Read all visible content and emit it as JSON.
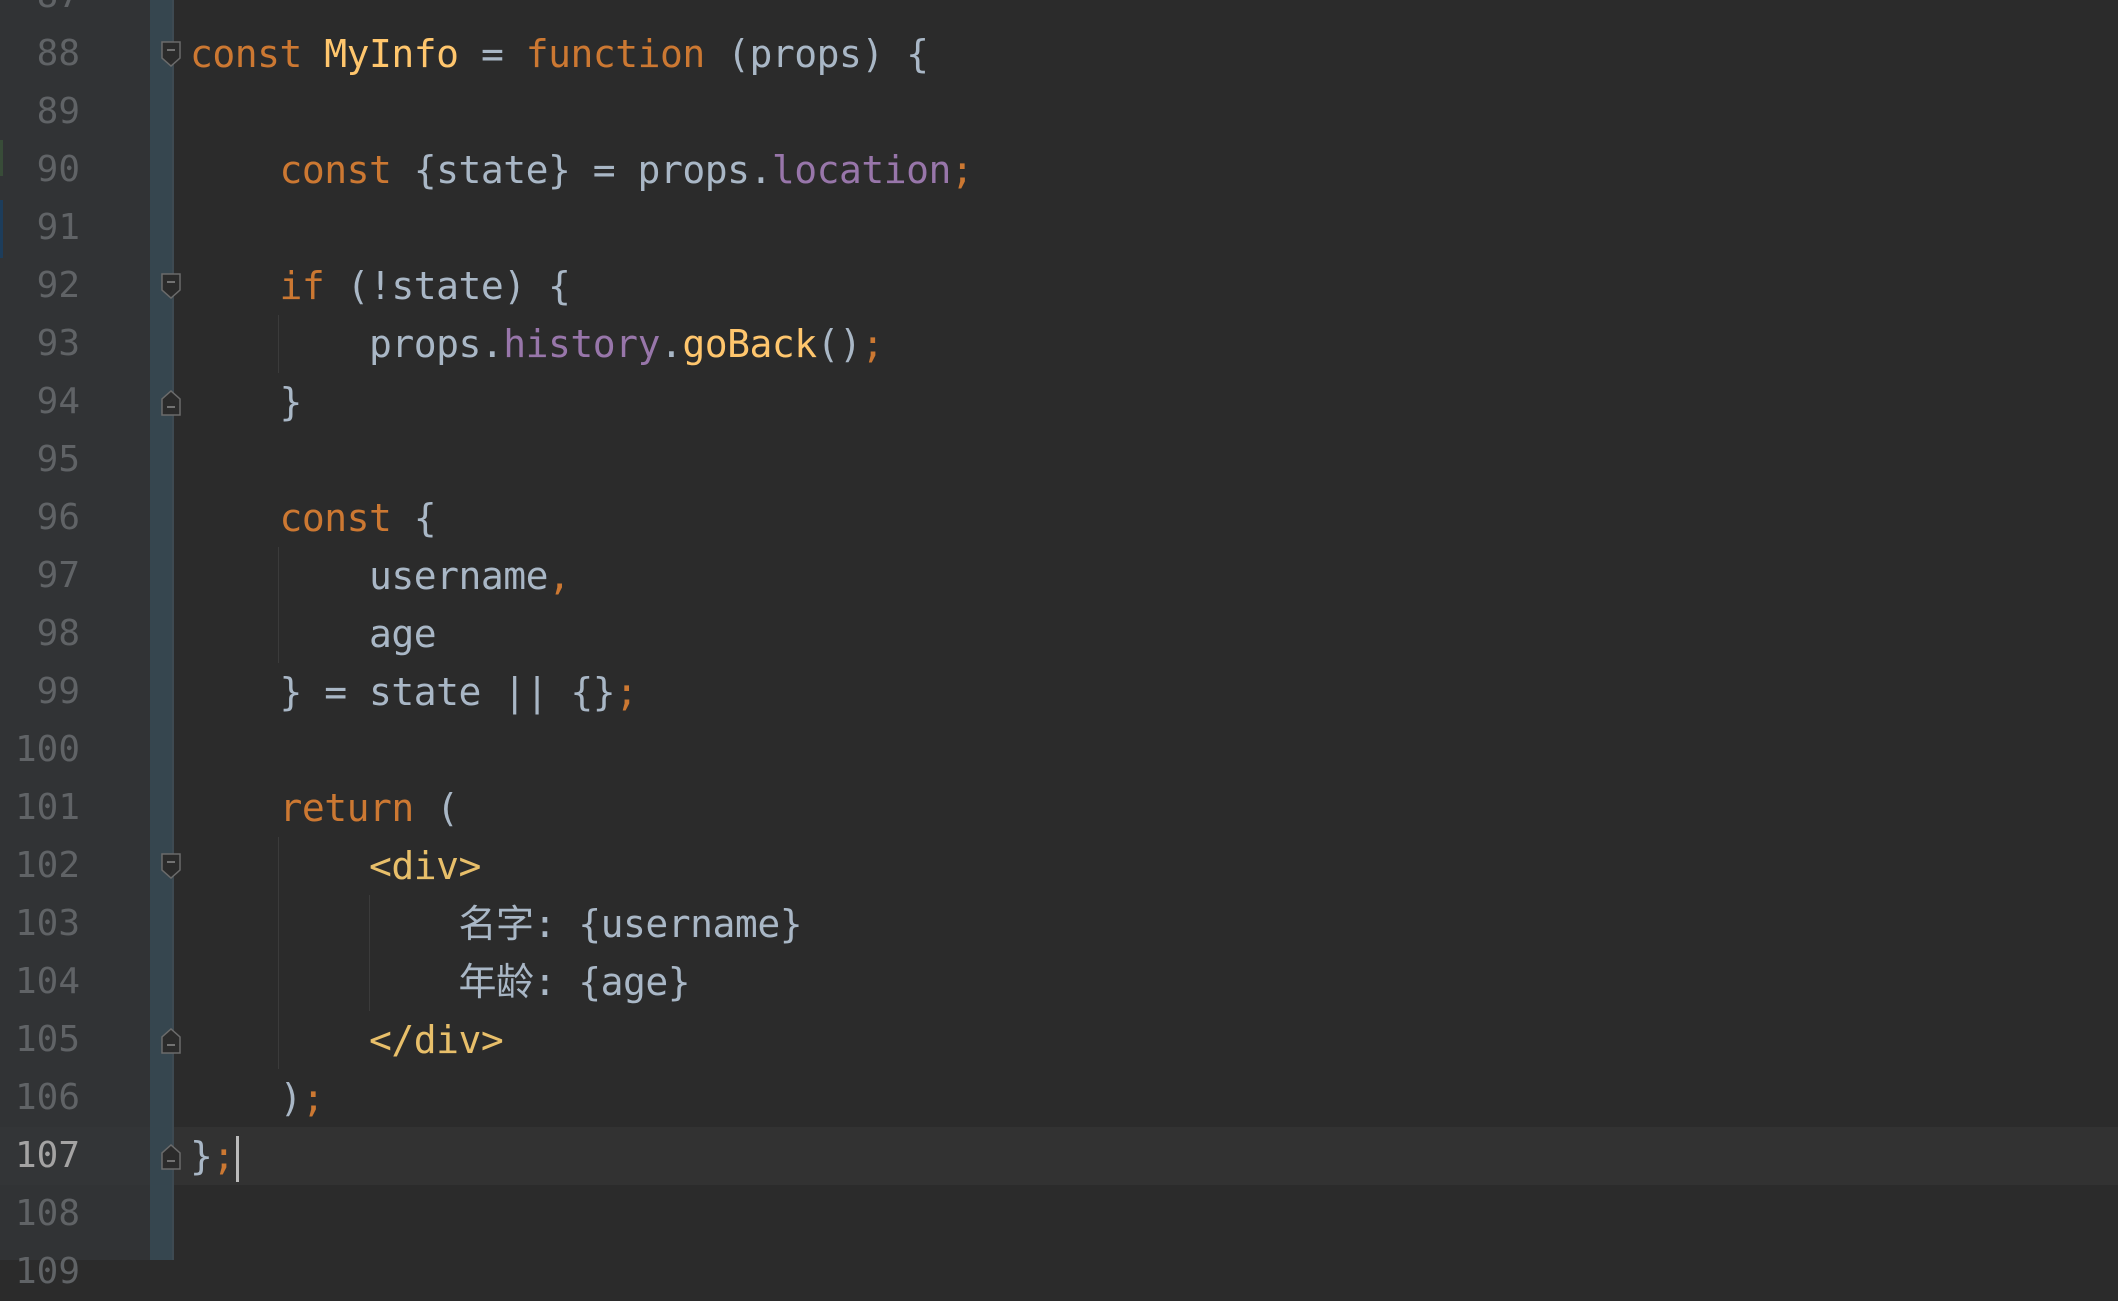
{
  "editor": {
    "colors": {
      "background": "#2b2b2b",
      "keyword": "#cc7832",
      "function": "#ffc66d",
      "property": "#9876aa",
      "tag": "#e8bf6a",
      "default": "#a9b7c6",
      "line_number": "#606366"
    },
    "current_line": 107,
    "lines": [
      {
        "n": "87",
        "tokens": []
      },
      {
        "n": "88",
        "fold": "open",
        "tokens": [
          {
            "t": "const ",
            "c": "kw"
          },
          {
            "t": "MyInfo",
            "c": "fn"
          },
          {
            "t": " = ",
            "c": "df"
          },
          {
            "t": "function ",
            "c": "kw"
          },
          {
            "t": "(props) {",
            "c": "df"
          }
        ]
      },
      {
        "n": "89",
        "tokens": []
      },
      {
        "n": "90",
        "tokens": [
          {
            "t": "    const ",
            "c": "kw"
          },
          {
            "t": "{state} = props.",
            "c": "df"
          },
          {
            "t": "location",
            "c": "pr"
          },
          {
            "t": ";",
            "c": "pn"
          }
        ]
      },
      {
        "n": "91",
        "tokens": []
      },
      {
        "n": "92",
        "fold": "open",
        "tokens": [
          {
            "t": "    if ",
            "c": "kw"
          },
          {
            "t": "(!state) {",
            "c": "df"
          }
        ]
      },
      {
        "n": "93",
        "tokens": [
          {
            "t": "        props.",
            "c": "df"
          },
          {
            "t": "history",
            "c": "pr"
          },
          {
            "t": ".",
            "c": "df"
          },
          {
            "t": "goBack",
            "c": "fn"
          },
          {
            "t": "()",
            "c": "df"
          },
          {
            "t": ";",
            "c": "pn"
          }
        ]
      },
      {
        "n": "94",
        "fold": "close",
        "tokens": [
          {
            "t": "    }",
            "c": "df"
          }
        ]
      },
      {
        "n": "95",
        "tokens": []
      },
      {
        "n": "96",
        "tokens": [
          {
            "t": "    const ",
            "c": "kw"
          },
          {
            "t": "{",
            "c": "df"
          }
        ]
      },
      {
        "n": "97",
        "tokens": [
          {
            "t": "        username",
            "c": "df"
          },
          {
            "t": ",",
            "c": "pn"
          }
        ]
      },
      {
        "n": "98",
        "tokens": [
          {
            "t": "        age",
            "c": "df"
          }
        ]
      },
      {
        "n": "99",
        "tokens": [
          {
            "t": "    } = state || {}",
            "c": "df"
          },
          {
            "t": ";",
            "c": "pn"
          }
        ]
      },
      {
        "n": "100",
        "tokens": []
      },
      {
        "n": "101",
        "tokens": [
          {
            "t": "    return ",
            "c": "kw"
          },
          {
            "t": "(",
            "c": "df"
          }
        ]
      },
      {
        "n": "102",
        "fold": "open",
        "tokens": [
          {
            "t": "        <div>",
            "c": "tag"
          }
        ]
      },
      {
        "n": "103",
        "tokens": [
          {
            "t": "            名字: {username}",
            "c": "df"
          }
        ]
      },
      {
        "n": "104",
        "tokens": [
          {
            "t": "            年龄: {age}",
            "c": "df"
          }
        ]
      },
      {
        "n": "105",
        "fold": "close",
        "tokens": [
          {
            "t": "        </div>",
            "c": "tag"
          }
        ]
      },
      {
        "n": "106",
        "tokens": [
          {
            "t": "    )",
            "c": "df"
          },
          {
            "t": ";",
            "c": "pn"
          }
        ]
      },
      {
        "n": "107",
        "fold": "close",
        "tokens": [
          {
            "t": "}",
            "c": "df"
          },
          {
            "t": ";",
            "c": "pn"
          }
        ]
      },
      {
        "n": "108",
        "tokens": []
      },
      {
        "n": "109",
        "tokens": []
      }
    ]
  }
}
